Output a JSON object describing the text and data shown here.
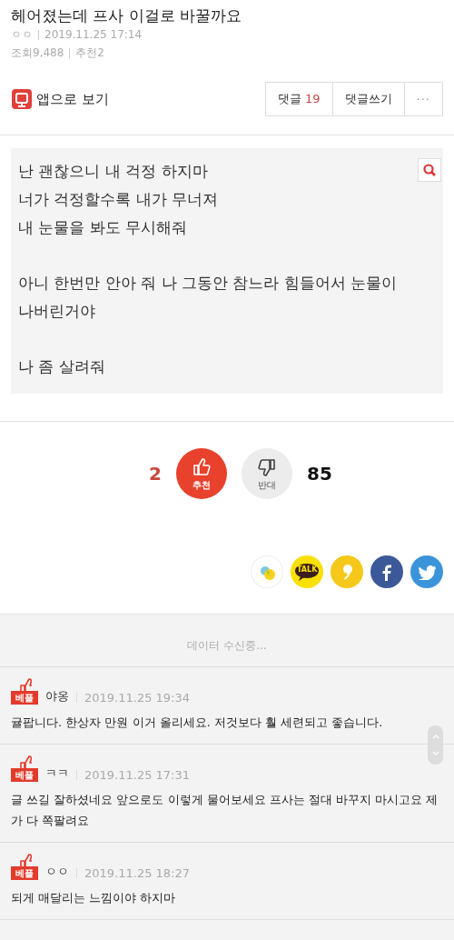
{
  "post": {
    "title": "헤어졌는데 프사 이걸로 바꿀까요",
    "author": "ㅇㅇ",
    "date": "2019.11.25 17:14",
    "views": "조회9,488",
    "recommends": "추천2"
  },
  "toolbar": {
    "app_link": "앱으로 보기",
    "comments_label": "댓글",
    "comments_count": "19",
    "write_comment": "댓글쓰기",
    "more": "···"
  },
  "quote": {
    "paragraphs": [
      [
        "난 괜찮으니 내 걱정 하지마",
        "너가 걱정할수록 내가 무너져",
        "내 눈물을 봐도 무시해줘"
      ],
      [
        "아니 한번만 안아 줘 나 그동안 참느라 힘들어서 눈물이",
        "나버린거야"
      ],
      [
        "나 좀 살려줘"
      ]
    ]
  },
  "votes": {
    "up_count": "2",
    "up_label": "추천",
    "down_label": "반대",
    "down_count": "85"
  },
  "share": [
    {
      "kind": "story"
    },
    {
      "kind": "talk",
      "label": "TALK"
    },
    {
      "kind": "kakaostory"
    },
    {
      "kind": "facebook"
    },
    {
      "kind": "twitter"
    }
  ],
  "loading": "데이터 수신중...",
  "comments": [
    {
      "badge": "베플",
      "author": "야옹",
      "date": "2019.11.25 19:34",
      "body": "귤팝니다. 한상자 만원 이거 올리세요. 저것보다 훨 세련되고 좋습니다."
    },
    {
      "badge": "베플",
      "author": "ㅋㅋ",
      "date": "2019.11.25 17:31",
      "body": "글 쓰길 잘하셨네요 앞으로도 이렇게 물어보세요 프사는 절대 바꾸지 마시고요 제가 다 쪽팔려요"
    },
    {
      "badge": "베플",
      "author": "ㅇㅇ",
      "date": "2019.11.25 18:27",
      "body": "되게 매달리는 느낌이야 하지마"
    }
  ]
}
